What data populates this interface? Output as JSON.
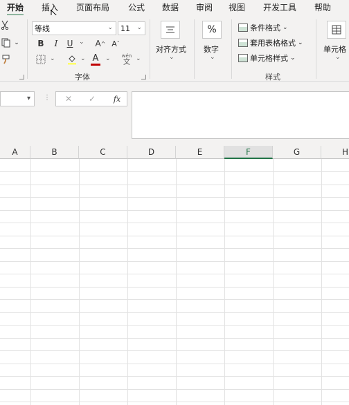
{
  "tabs": [
    {
      "label": "开始",
      "active": true
    },
    {
      "label": "插入"
    },
    {
      "label": "页面布局"
    },
    {
      "label": "公式"
    },
    {
      "label": "数据"
    },
    {
      "label": "审阅"
    },
    {
      "label": "视图"
    },
    {
      "label": "开发工具"
    },
    {
      "label": "帮助"
    }
  ],
  "font": {
    "name": "等线",
    "size": "11",
    "bold": "B",
    "italic": "I",
    "underline": "U",
    "grow": "A",
    "shrink": "A",
    "font_color_letter": "A",
    "wen_top": "wén",
    "wen_bottom": "文",
    "group_label": "字体"
  },
  "alignment": {
    "label": "对齐方式"
  },
  "number": {
    "icon": "%",
    "label": "数字"
  },
  "styles": {
    "conditional": "条件格式",
    "table_format": "套用表格格式",
    "cell_styles": "单元格样式",
    "group_label": "样式"
  },
  "cells_group": {
    "label": "单元格"
  },
  "formula_bar": {
    "fx": "fx",
    "cancel": "✕",
    "enter": "✓"
  },
  "columns": [
    "A",
    "B",
    "C",
    "D",
    "E",
    "F",
    "G",
    "H"
  ],
  "selected_column": "F",
  "colors": {
    "accent": "#217346",
    "font_color_bar": "#c00000"
  }
}
